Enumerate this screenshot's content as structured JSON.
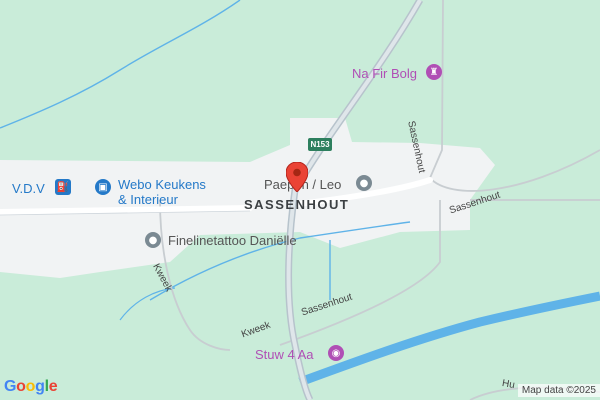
{
  "place": {
    "name": "SASSENHOUT"
  },
  "road_shield": {
    "label": "N153",
    "color": "#2d7f5e"
  },
  "pois": {
    "na_fir_bolg": {
      "label": "Na Fir Bolg",
      "icon": "attraction-icon",
      "color": "#b04fb5"
    },
    "paepon_leo": {
      "label": "Paepon / Leo",
      "icon": "place-icon",
      "color": "#7b8a93"
    },
    "vdv": {
      "label": "V.D.V",
      "icon": "gas-station-icon",
      "color": "#2479c8"
    },
    "webo": {
      "label_line1": "Webo Keukens",
      "label_line2": "& Interieur",
      "icon": "shopping-bag-icon",
      "color": "#2479c8"
    },
    "fineline": {
      "label": "Finelinetattoo Daniëlle",
      "icon": "place-icon",
      "color": "#7b8a93"
    },
    "stuw": {
      "label": "Stuw 4 Aa",
      "icon": "camera-icon",
      "color": "#b04fb5"
    }
  },
  "roads": {
    "sassenhout_ne": "Sassenhout",
    "sassenhout_e": "Sassenhout",
    "sassenhout_s": "Sassenhout",
    "kweek_w": "Kweek",
    "kweek_s": "Kweek",
    "hu": "Hu"
  },
  "map_pin": {
    "icon": "map-pin-icon",
    "color": "#ea4335"
  },
  "footer": {
    "logo": "Google",
    "attribution": "Map data ©2025"
  },
  "colors": {
    "background": "#c9ecd9",
    "urban": "#f1f3f4",
    "water": "#5fb3e8",
    "road": "#ffffff"
  }
}
